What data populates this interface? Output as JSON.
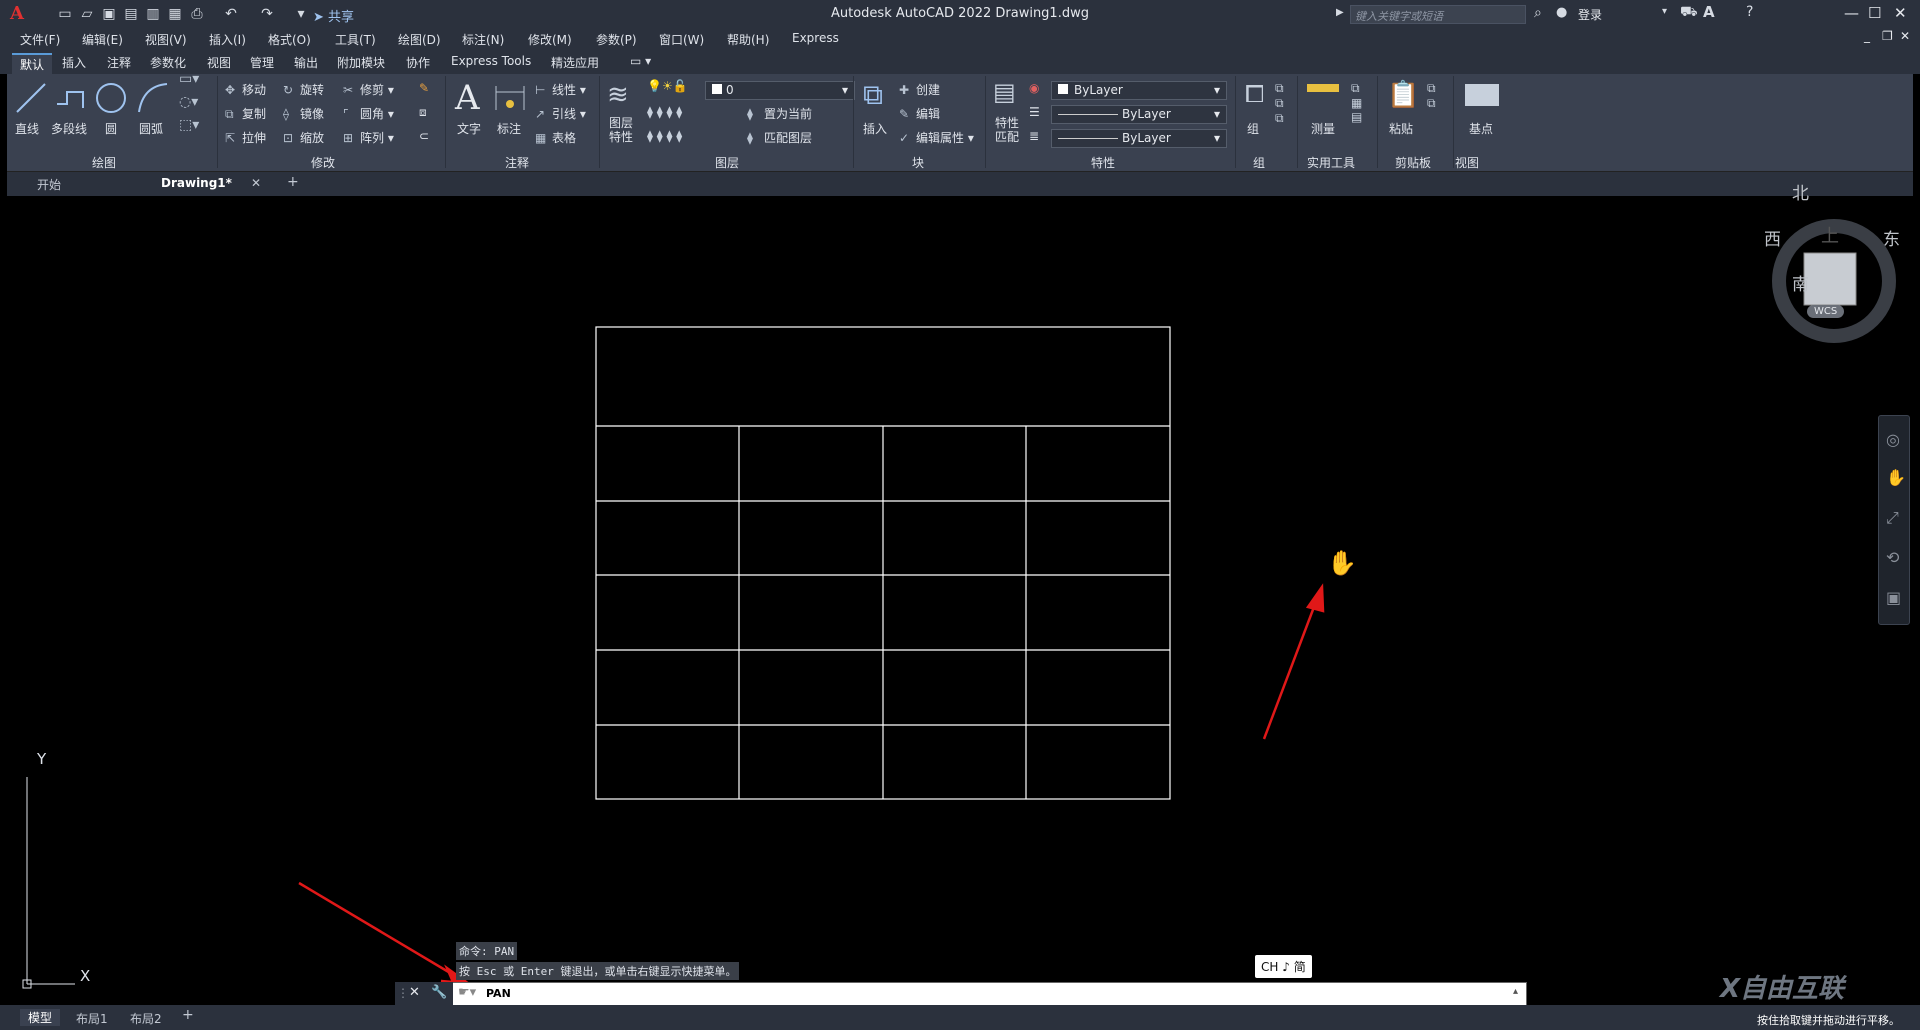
{
  "app": {
    "title": "Autodesk AutoCAD 2022    Drawing1.dwg",
    "logo": "A",
    "share_label": "共享",
    "search_placeholder": "键入关键字或短语",
    "login_label": "登录"
  },
  "menu": [
    "文件(F)",
    "编辑(E)",
    "视图(V)",
    "插入(I)",
    "格式(O)",
    "工具(T)",
    "绘图(D)",
    "标注(N)",
    "修改(M)",
    "参数(P)",
    "窗口(W)",
    "帮助(H)",
    "Express"
  ],
  "ribbon_tabs": [
    "默认",
    "插入",
    "注释",
    "参数化",
    "视图",
    "管理",
    "输出",
    "附加模块",
    "协作",
    "Express Tools",
    "精选应用"
  ],
  "ribbon": {
    "draw": {
      "title": "绘图",
      "line": "直线",
      "polyline": "多段线",
      "circle": "圆",
      "arc": "圆弧"
    },
    "modify": {
      "title": "修改",
      "move": "移动",
      "rotate": "旋转",
      "trim": "修剪",
      "copy": "复制",
      "mirror": "镜像",
      "fillet": "圆角",
      "stretch": "拉伸",
      "scale": "缩放",
      "array": "阵列"
    },
    "annotation": {
      "title": "注释",
      "text": "文字",
      "dimension": "标注",
      "linear": "线性",
      "leader": "引线",
      "table": "表格"
    },
    "layers": {
      "title": "图层",
      "layer_props": "图层\n特性",
      "layer_value": "0",
      "set_current": "置为当前",
      "match_layer": "匹配图层"
    },
    "block": {
      "title": "块",
      "insert": "插入",
      "create": "创建",
      "edit": "编辑",
      "edit_attr": "编辑属性"
    },
    "properties": {
      "title": "特性",
      "match": "特性\n匹配",
      "color": "ByLayer",
      "linetype": "ByLayer",
      "lineweight": "ByLayer"
    },
    "groups": {
      "title": "组",
      "group": "组"
    },
    "utilities": {
      "title": "实用工具",
      "measure": "测量"
    },
    "clipboard": {
      "title": "剪贴板",
      "paste": "粘贴"
    },
    "view": {
      "title": "视图",
      "base": "基点"
    }
  },
  "doc_tabs": [
    "开始",
    "Drawing1*"
  ],
  "viewcube": {
    "north": "北",
    "south": "南",
    "east": "东",
    "west": "西",
    "top": "上",
    "wcs": "WCS"
  },
  "ucs": {
    "x": "X",
    "y": "Y"
  },
  "command": {
    "history": [
      "命令: PAN",
      "按 Esc 或 Enter 键退出，或单击右键显示快捷菜单。"
    ],
    "current": "PAN"
  },
  "ime": "CH ♪ 简",
  "status_tabs": [
    "模型",
    "布局1",
    "布局2"
  ],
  "status_hint": "按住拾取键并拖动进行平移。",
  "watermark": "X自由互联"
}
